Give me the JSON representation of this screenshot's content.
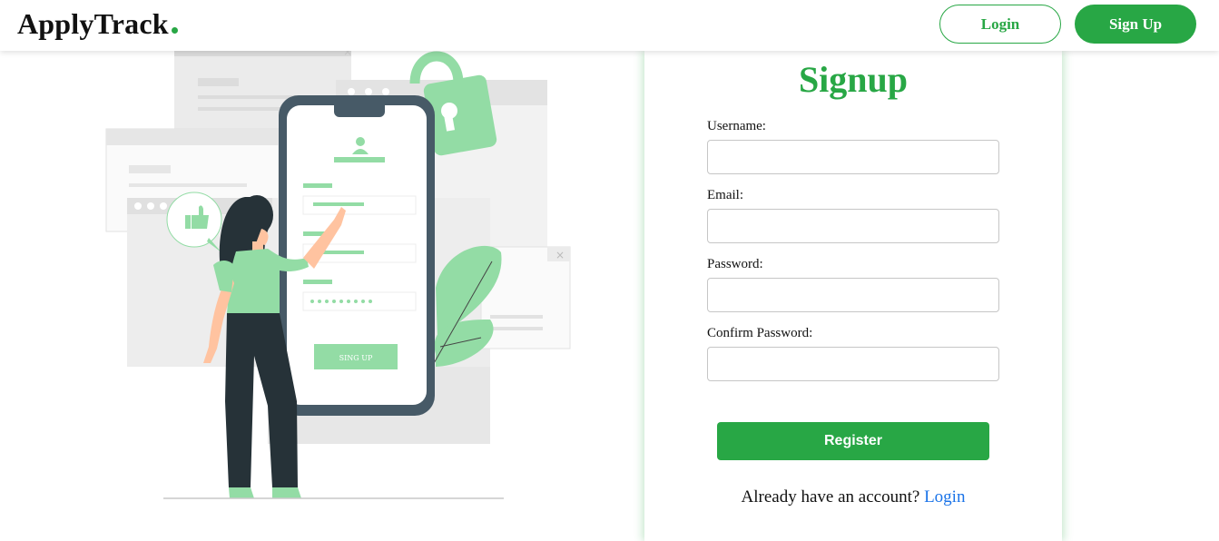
{
  "header": {
    "brand": "ApplyTrack",
    "login_label": "Login",
    "signup_label": "Sign Up"
  },
  "illustration": {
    "phone_button_label": "SING UP"
  },
  "form": {
    "title": "Signup",
    "fields": [
      {
        "label": "Username:",
        "value": ""
      },
      {
        "label": "Email:",
        "value": ""
      },
      {
        "label": "Password:",
        "value": ""
      },
      {
        "label": "Confirm Password:",
        "value": ""
      }
    ],
    "register_label": "Register",
    "account_prompt": "Already have an account?",
    "login_link": "Login"
  },
  "colors": {
    "accent": "#28a745",
    "light_green": "#93dca5",
    "link": "#1a73e8"
  }
}
